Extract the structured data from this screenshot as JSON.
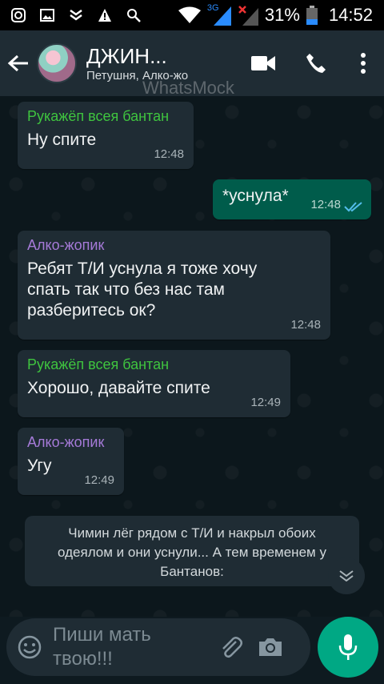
{
  "status_bar": {
    "icons": [
      "instagram-icon",
      "gallery-icon",
      "shield-icon",
      "warning-icon",
      "search-icon",
      "wifi-icon",
      "signal-3g-icon",
      "signal-x-icon",
      "battery-icon"
    ],
    "network_label": "3G",
    "battery_percent": "31%",
    "time": "14:52"
  },
  "header": {
    "title": "ДЖИН...",
    "subtitle": "Петушня, Алко-жо",
    "watermark": "WhatsMock"
  },
  "messages": [
    {
      "sender": "Рукажёп всея бантан",
      "sender_color": "#3fc43f",
      "text": "Ну спите",
      "time": "12:48",
      "direction": "in"
    },
    {
      "text": "*уснула*",
      "time": "12:48",
      "direction": "out",
      "read": true
    },
    {
      "sender": "Алко-жопик",
      "sender_color": "#a57ad8",
      "text": "Ребят Т/И уснула я тоже хочу спать так что без нас там разберитесь ок?",
      "time": "12:48",
      "direction": "in"
    },
    {
      "sender": "Рукажёп всея бантан",
      "sender_color": "#3fc43f",
      "text": "Хорошо, давайте спите",
      "time": "12:49",
      "direction": "in"
    },
    {
      "sender": "Алко-жопик",
      "sender_color": "#a57ad8",
      "text": "Угу",
      "time": "12:49",
      "direction": "in"
    }
  ],
  "system_message": "Чимин лёг рядом с Т/И и накрыл обоих одеялом и они уснули... А тем временем у Бантанов:",
  "input": {
    "placeholder": "Пиши мать твою!!!"
  },
  "colors": {
    "header_bg": "#1f2c34",
    "incoming_bubble": "#1f2c34",
    "outgoing_bubble": "#005c4b",
    "accent": "#00a884",
    "read_ticks": "#53bdeb"
  }
}
